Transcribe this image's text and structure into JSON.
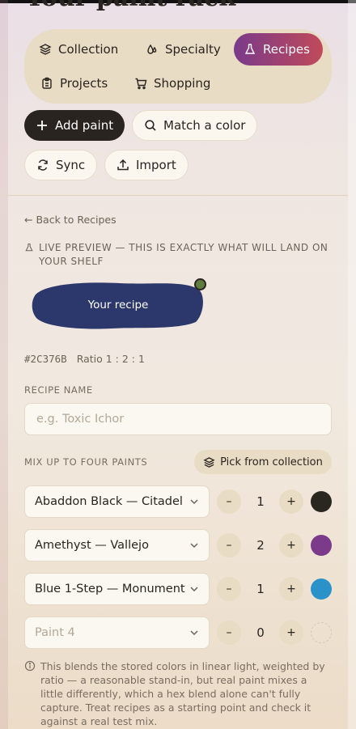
{
  "header": {
    "title": "Your paint rack"
  },
  "tabs": [
    {
      "label": "Collection",
      "icon": "layers-icon"
    },
    {
      "label": "Specialty",
      "icon": "drops-icon"
    },
    {
      "label": "Recipes",
      "icon": "flask-icon",
      "active": true
    },
    {
      "label": "Projects",
      "icon": "clipboard-icon"
    },
    {
      "label": "Shopping",
      "icon": "cart-icon"
    }
  ],
  "actions": {
    "add_paint": "Add paint",
    "match_color": "Match a color",
    "sync": "Sync",
    "import": "Import"
  },
  "recipe": {
    "back_label": "Back to Recipes",
    "preview_note": "Live preview — this is exactly what will land on your shelf",
    "swatch_label": "Your recipe",
    "swatch_color": "#2C376B",
    "hex": "#2C376B",
    "ratio_label": "Ratio 1 : 2 : 1",
    "name_label": "Recipe name",
    "name_placeholder": "e.g. Toxic Ichor",
    "name_value": "",
    "mix_label": "Mix up to four paints",
    "pick_label": "Pick from collection",
    "paints": [
      {
        "name": "Abaddon Black — Citadel",
        "count": "1",
        "color": "#2a2620"
      },
      {
        "name": "Amethyst — Vallejo",
        "count": "2",
        "color": "#7b3a8a"
      },
      {
        "name": "Blue 1-Step — Monument",
        "count": "1",
        "color": "#2a92c8"
      },
      {
        "name": "Paint 4",
        "count": "0",
        "color": "",
        "empty": true
      }
    ],
    "footnote": "This blends the stored colors in linear light, weighted by ratio — a reasonable stand-in, but real paint mixes a little differently, which a hex blend alone can't fully capture. Treat recipes as a starting point and check it against a real test mix."
  },
  "colors": {
    "accent_gradient_start": "#7a3a8a",
    "accent_gradient_end": "#c04a5a",
    "status_dot": "#5f7d3c"
  }
}
